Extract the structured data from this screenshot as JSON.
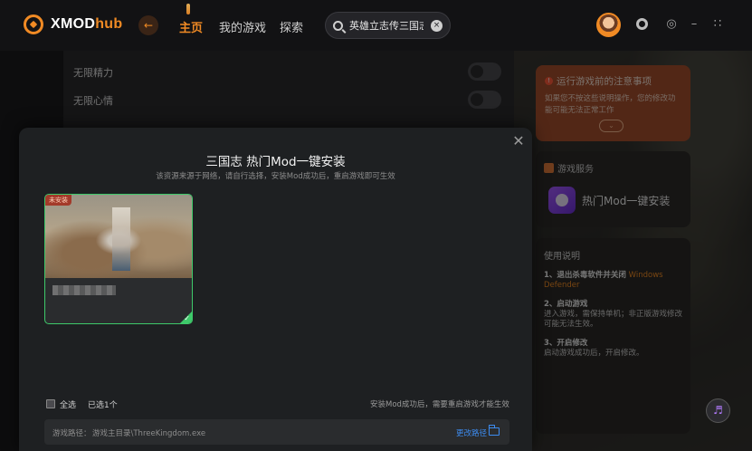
{
  "app": {
    "brand_prefix": "XMOD",
    "brand_suffix": "hub"
  },
  "nav": {
    "items": [
      "主页",
      "我的游戏",
      "探索"
    ],
    "active": "主页"
  },
  "search": {
    "value": "英雄立志传三国志"
  },
  "settings_rows": [
    {
      "label": "无限精力"
    },
    {
      "label": "无限心情"
    }
  ],
  "notice": {
    "title": "运行游戏前的注意事项",
    "text": "如果您不按这些说明操作，您的修改功能可能无法正常工作"
  },
  "service": {
    "title": "游戏服务",
    "item_label": "热门Mod一键安装"
  },
  "guide": {
    "title": "使用说明",
    "steps": [
      {
        "head": "1、退出杀毒软件并关闭",
        "highlight": "Windows Defender",
        "body": ""
      },
      {
        "head": "2、启动游戏",
        "highlight": "",
        "body": "进入游戏，需保持单机；非正版游戏修改可能无法生效。"
      },
      {
        "head": "3、开启修改",
        "highlight": "",
        "body": "启动游戏成功后，开启修改。"
      }
    ]
  },
  "modal": {
    "title": "三国志 热门Mod一键安装",
    "subtitle": "该资源来源于网络，请自行选择，安装Mod成功后，重启游戏即可生效",
    "mod_card": {
      "badge": "未安装"
    },
    "select_all_label": "全选",
    "selected_count": "已选1个",
    "note": "安装Mod成功后，需要重启游戏才能生效",
    "path_label": "游戏路径：",
    "path_value": "游戏主目录\\ThreeKingdom.exe",
    "change_path_label": "更改路径"
  },
  "colors": {
    "accent": "#f08a24",
    "selected": "#3ec96a",
    "link": "#3d8cf0"
  }
}
